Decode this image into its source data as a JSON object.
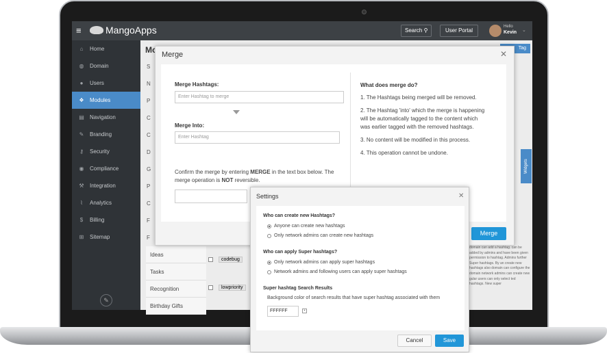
{
  "topbar": {
    "app_name": "MangoApps",
    "search_label": "Search",
    "portal_label": "User Portal",
    "greeting": "Hello",
    "user_name": "Kevin"
  },
  "sidebar": {
    "items": [
      {
        "label": "Home",
        "icon": "home-icon",
        "glyph": "⌂"
      },
      {
        "label": "Domain",
        "icon": "globe-icon",
        "glyph": "◍"
      },
      {
        "label": "Users",
        "icon": "user-icon",
        "glyph": "●"
      },
      {
        "label": "Modules",
        "icon": "modules-icon",
        "glyph": "❖"
      },
      {
        "label": "Navigation",
        "icon": "navigation-icon",
        "glyph": "▤"
      },
      {
        "label": "Branding",
        "icon": "brush-icon",
        "glyph": "✎"
      },
      {
        "label": "Security",
        "icon": "key-icon",
        "glyph": "⚷"
      },
      {
        "label": "Compliance",
        "icon": "shield-icon",
        "glyph": "◉"
      },
      {
        "label": "Integration",
        "icon": "wrench-icon",
        "glyph": "⚒"
      },
      {
        "label": "Analytics",
        "icon": "chart-icon",
        "glyph": "⌇"
      },
      {
        "label": "Billing",
        "icon": "dollar-icon",
        "glyph": "$"
      },
      {
        "label": "Sitemap",
        "icon": "sitemap-icon",
        "glyph": "⊞"
      }
    ],
    "active_index": 3
  },
  "background": {
    "page_title": "Mo",
    "tag_button": "Tag",
    "widgets_label": "Widgets",
    "list_letters": [
      "S",
      "N",
      "P",
      "C",
      "C",
      "D",
      "G",
      "P",
      "C",
      "F",
      "F"
    ],
    "list_items": [
      "Ideas",
      "Tasks",
      "Recognition",
      "Birthday Gifts"
    ],
    "tags": [
      "codebug",
      "lowpriority"
    ],
    "right_text": "domain can add a hashtag. can be added by admins and have been given permission to hashtag. Admins further Super hashtags. By an create new hashtags also domain can configure the domain network admins can create new gular users can only select ted hashtags. New super"
  },
  "merge_dialog": {
    "title": "Merge",
    "merge_label": "Merge Hashtags:",
    "merge_placeholder": "Enter Hashtag to merge",
    "into_label": "Merge Into:",
    "into_placeholder": "Enter Hashtag",
    "confirm_pre": "Confirm the merge by entering ",
    "confirm_keyword": "MERGE",
    "confirm_mid": " in the text box below. The merge operation is ",
    "confirm_not": "NOT",
    "confirm_post": " reversible.",
    "what_title": "What does merge do?",
    "rules": [
      "1. The Hashtags being merged will be removed.",
      "2. The Hashtag 'into' which the merge is happening will be automatically tagged to the content which was earlier tagged with the removed hashtags.",
      "3. No content will be modified in this process.",
      "4. This operation cannot be undone."
    ],
    "merge_button": "Merge"
  },
  "settings_dialog": {
    "title": "Settings",
    "create_heading": "Who can create new Hashtags?",
    "create_options": [
      "Anyone can create new hashtags",
      "Only network admins can create new hashtags"
    ],
    "create_selected": 0,
    "super_heading": "Who can apply Super hashtags?",
    "super_options": [
      "Only network admins can apply super hashtags",
      "Network admins and following users can apply super hashtags"
    ],
    "super_selected": 0,
    "results_heading": "Super hashtag Search Results",
    "results_desc": "Background color of search results that have super hashtag associated with them",
    "color_value": "FFFFFF",
    "cancel_button": "Cancel",
    "save_button": "Save"
  }
}
